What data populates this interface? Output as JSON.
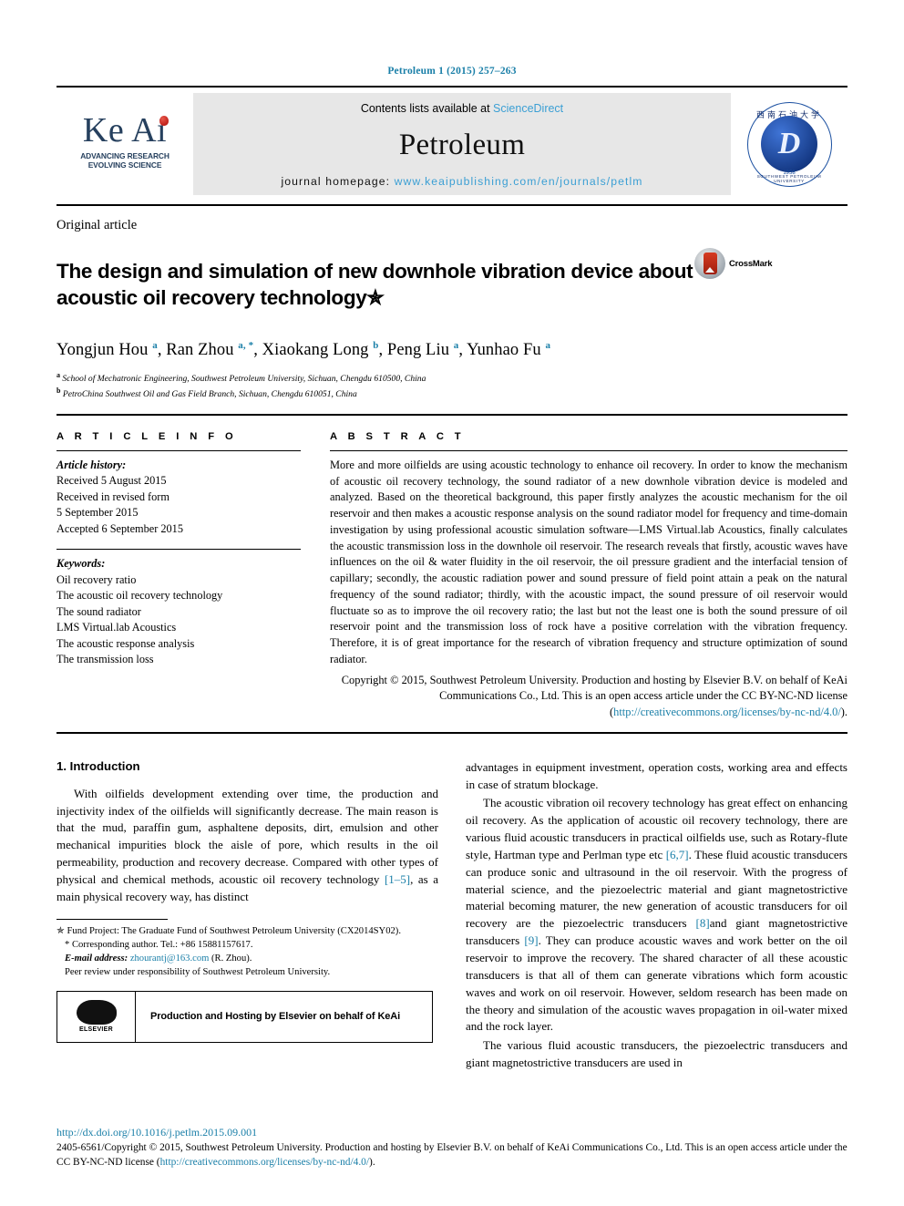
{
  "running_head": "Petroleum 1 (2015) 257–263",
  "masthead": {
    "logo_word": "Ke Ai",
    "logo_tagline_line1": "ADVANCING RESEARCH",
    "logo_tagline_line2": "EVOLVING SCIENCE",
    "contents_prefix": "Contents lists available at ",
    "contents_link": "ScienceDirect",
    "journal_name": "Petroleum",
    "homepage_prefix": "journal homepage: ",
    "homepage_url": "www.keaipublishing.com/en/journals/petlm",
    "seal_cn": "西南石油大学",
    "seal_mark": "D",
    "seal_year": "1958",
    "seal_en": "SOUTHWEST PETROLEUM UNIVERSITY"
  },
  "article": {
    "kind": "Original article",
    "title": "The design and simulation of new downhole vibration device about acoustic oil recovery technology✯",
    "crossmark_label": "CrossMark",
    "authors_html": "Yongjun Hou <sup>a</sup>, Ran Zhou <sup>a, *</sup>, Xiaokang Long <sup>b</sup>, Peng Liu <sup>a</sup>, Yunhao Fu <sup>a</sup>",
    "affiliation_a": "School of Mechatronic Engineering, Southwest Petroleum University, Sichuan, Chengdu 610500, China",
    "affiliation_b": "PetroChina Southwest Oil and Gas Field Branch, Sichuan, Chengdu 610051, China"
  },
  "info": {
    "heading": "A R T I C L E   I N F O",
    "history_label": "Article history:",
    "history": [
      "Received 5 August 2015",
      "Received in revised form",
      "5 September 2015",
      "Accepted 6 September 2015"
    ],
    "keywords_label": "Keywords:",
    "keywords": [
      "Oil recovery ratio",
      "The acoustic oil recovery technology",
      "The sound radiator",
      "LMS Virtual.lab Acoustics",
      "The acoustic response analysis",
      "The transmission loss"
    ]
  },
  "abstract": {
    "heading": "A B S T R A C T",
    "text": "More and more oilfields are using acoustic technology to enhance oil recovery. In order to know the mechanism of acoustic oil recovery technology, the sound radiator of a new downhole vibration device is modeled and analyzed. Based on the theoretical background, this paper firstly analyzes the acoustic mechanism for the oil reservoir and then makes a acoustic response analysis on the sound radiator model for frequency and time-domain investigation by using professional acoustic simulation software—LMS Virtual.lab Acoustics, finally calculates the acoustic transmission loss in the downhole oil reservoir. The research reveals that firstly, acoustic waves have influences on the oil & water fluidity in the oil reservoir, the oil pressure gradient and the interfacial tension of capillary; secondly, the acoustic radiation power and sound pressure of field point attain a peak on the natural frequency of the sound radiator; thirdly, with the acoustic impact, the sound pressure of oil reservoir would fluctuate so as to improve the oil recovery ratio; the last but not the least one is both the sound pressure of oil reservoir point and the transmission loss of rock have a positive correlation with the vibration frequency. Therefore, it is of great importance for the research of vibration frequency and structure optimization of sound radiator.",
    "copyright": "Copyright © 2015, Southwest Petroleum University. Production and hosting by Elsevier B.V. on behalf of KeAi Communications Co., Ltd. This is an open access article under the CC BY-NC-ND license (",
    "copyright_link": "http://creativecommons.org/licenses/by-nc-nd/4.0/",
    "copyright_tail": ")."
  },
  "body": {
    "section_number_title": "1.  Introduction",
    "left_paragraphs": [
      "With oilfields development extending over time, the production and injectivity index of the oilfields will significantly decrease. The main reason is that the mud, paraffin gum, asphaltene deposits, dirt, emulsion and other mechanical impurities block the aisle of pore, which results in the oil permeability, production and recovery decrease. Compared with other types of physical and chemical methods, acoustic oil recovery technology [1–5], as a main physical recovery way, has distinct"
    ],
    "left_ref": "[1–5]",
    "right_paragraphs": [
      "advantages in equipment investment, operation costs, working area and effects in case of stratum blockage.",
      "The acoustic vibration oil recovery technology has great effect on enhancing oil recovery. As the application of acoustic oil recovery technology, there are various fluid acoustic transducers in practical oilfields use, such as Rotary-flute style, Hartman type and Perlman type etc [6,7]. These fluid acoustic transducers can produce sonic and ultrasound in the oil reservoir. With the progress of material science, and the piezoelectric material and giant magnetostrictive material becoming maturer, the new generation of acoustic transducers for oil recovery are the piezoelectric transducers [8]and giant magnetostrictive transducers [9]. They can produce acoustic waves and work better on the oil reservoir to improve the recovery. The shared character of all these acoustic transducers is that all of them can generate vibrations which form acoustic waves and work on oil reservoir. However, seldom research has been made on the theory and simulation of the acoustic waves propagation in oil-water mixed and the rock layer.",
      "The various fluid acoustic transducers, the piezoelectric transducers and giant magnetostrictive transducers are used in"
    ],
    "right_refs": [
      "[6,7]",
      "[8]",
      "[9]"
    ]
  },
  "footnotes": {
    "fund_star": "✯",
    "fund": " Fund Project: The Graduate Fund of Southwest Petroleum University (CX2014SY02).",
    "corresponding_star": "*",
    "corresponding": " Corresponding author. Tel.: +86 15881157617.",
    "email_label": "E-mail address:",
    "email": "zhourantj@163.com",
    "email_tail": " (R. Zhou).",
    "peer_review": "Peer review under responsibility of Southwest Petroleum University.",
    "elsevier_logo_word": "ELSEVIER",
    "elsevier_text": "Production and Hosting by Elsevier on behalf of KeAi"
  },
  "footer": {
    "doi": "http://dx.doi.org/10.1016/j.petlm.2015.09.001",
    "issn_copyright": "2405-6561/Copyright © 2015, Southwest Petroleum University. Production and hosting by Elsevier B.V. on behalf of KeAi Communications Co., Ltd. This is an open access article under the CC BY-NC-ND license (",
    "license_link": "http://creativecommons.org/licenses/by-nc-nd/4.0/",
    "license_tail": ")."
  },
  "colors": {
    "link": "#1a7fa8",
    "sciencedirect": "#3b9fd4",
    "keai_navy": "#26405e",
    "keai_red": "#c0201b",
    "seal_blue": "#12357f"
  }
}
